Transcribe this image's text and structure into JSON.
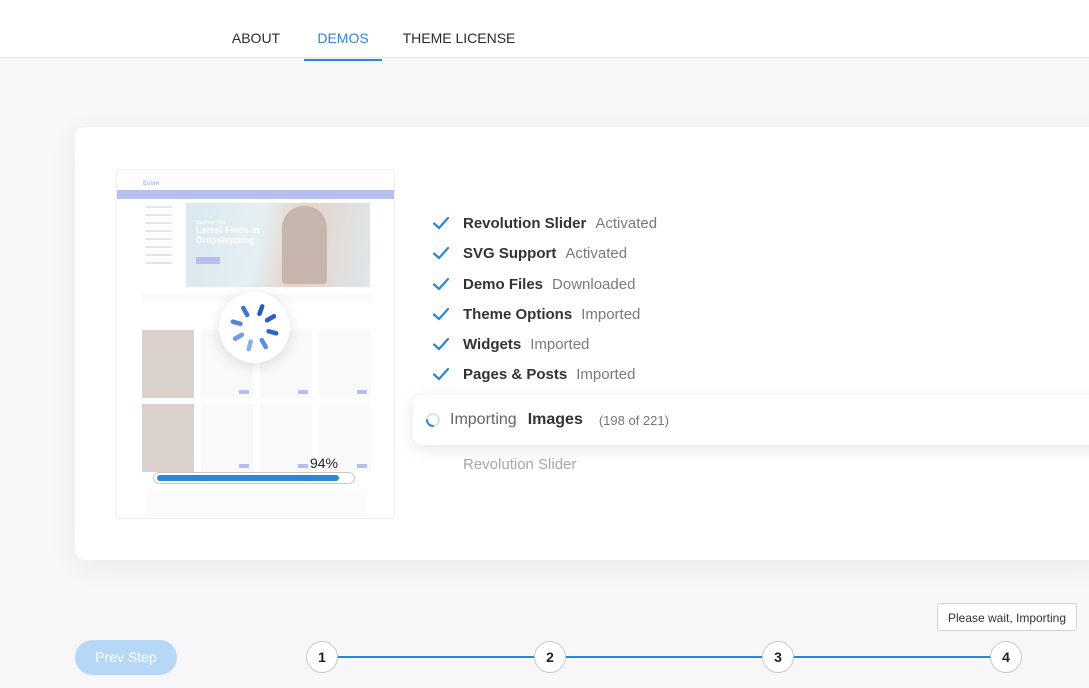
{
  "tabs": [
    {
      "label": "ABOUT",
      "active": false
    },
    {
      "label": "DEMOS",
      "active": true
    },
    {
      "label": "THEME LICENSE",
      "active": false
    }
  ],
  "preview": {
    "logo": "Ecom",
    "hero_subtitle": "Summer Sale",
    "hero_title": "Latest Finds in Dropshipping"
  },
  "progress": {
    "percent_label": "94%",
    "percent": 94
  },
  "steps": [
    {
      "name": "Revolution Slider",
      "status": "Activated"
    },
    {
      "name": "SVG Support",
      "status": "Activated"
    },
    {
      "name": "Demo Files",
      "status": "Downloaded"
    },
    {
      "name": "Theme Options",
      "status": "Imported"
    },
    {
      "name": "Widgets",
      "status": "Imported"
    },
    {
      "name": "Pages & Posts",
      "status": "Imported"
    }
  ],
  "importing": {
    "label": "Importing",
    "target": "Images",
    "count": "(198 of 221)"
  },
  "next_item": "Revolution Slider",
  "tooltip": "Please wait, Importing",
  "prev_button": "Prev Step",
  "stepper": [
    "1",
    "2",
    "3",
    "4"
  ],
  "colors": {
    "accent": "#2b86d8",
    "prev_button_bg": "#b6d8f6",
    "check": "#2b86d8"
  }
}
